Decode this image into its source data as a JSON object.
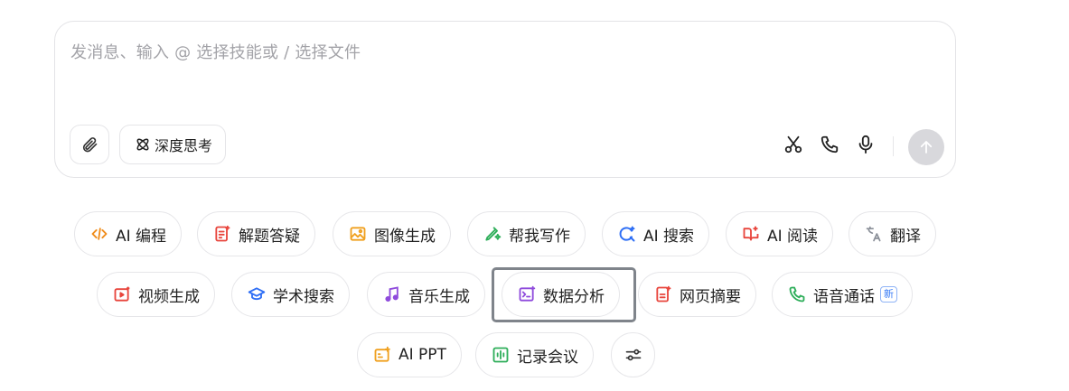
{
  "composer": {
    "placeholder": "发消息、输入 @ 选择技能或 / 选择文件",
    "deep_think_label": "深度思考"
  },
  "chips": [
    {
      "label": "AI 编程",
      "icon": "code-icon",
      "color": "#f08c1a"
    },
    {
      "label": "解题答疑",
      "icon": "question-icon",
      "color": "#e8453c"
    },
    {
      "label": "图像生成",
      "icon": "image-icon",
      "color": "#f0a01f"
    },
    {
      "label": "帮我写作",
      "icon": "pen-icon",
      "color": "#2eae5a"
    },
    {
      "label": "AI 搜索",
      "icon": "search-icon",
      "color": "#2f6ff5"
    },
    {
      "label": "AI 阅读",
      "icon": "book-icon",
      "color": "#e8453c"
    },
    {
      "label": "翻译",
      "icon": "translate-icon",
      "color": "#8a8f98"
    },
    {
      "label": "视频生成",
      "icon": "video-icon",
      "color": "#e8453c"
    },
    {
      "label": "学术搜索",
      "icon": "academic-icon",
      "color": "#2f6ff5"
    },
    {
      "label": "音乐生成",
      "icon": "music-icon",
      "color": "#8f4bdc"
    },
    {
      "label": "数据分析",
      "icon": "data-analysis-icon",
      "color": "#8f4bdc"
    },
    {
      "label": "网页摘要",
      "icon": "web-summary-icon",
      "color": "#e8453c"
    },
    {
      "label": "语音通话",
      "icon": "phone-icon",
      "color": "#2eae5a",
      "badge": "新"
    },
    {
      "label": "AI PPT",
      "icon": "ppt-icon",
      "color": "#f0a01f"
    },
    {
      "label": "记录会议",
      "icon": "meeting-icon",
      "color": "#2eae5a"
    }
  ]
}
